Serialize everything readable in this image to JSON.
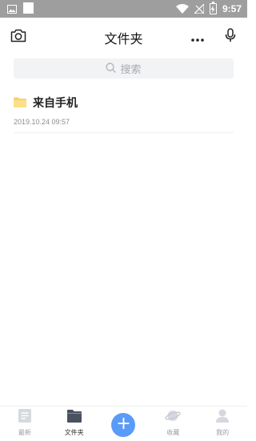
{
  "status_bar": {
    "time": "9:57",
    "left_icons": [
      "image-icon",
      "sim-card-icon"
    ],
    "right_icons": [
      "wifi-icon",
      "no-signal-icon",
      "battery-charging-icon"
    ]
  },
  "header": {
    "title": "文件夹",
    "left_icon": "camera-icon",
    "right_icons": [
      "more-icon",
      "microphone-icon"
    ]
  },
  "search": {
    "placeholder": "搜索"
  },
  "folders": [
    {
      "name": "来自手机",
      "date": "2019.10.24 09:57",
      "icon": "folder-icon"
    }
  ],
  "bottom_nav": {
    "items": [
      {
        "label": "最新",
        "icon": "document-icon",
        "active": false
      },
      {
        "label": "文件夹",
        "icon": "folder-icon",
        "active": true
      },
      {
        "label": "+",
        "icon": "add-icon",
        "active": false
      },
      {
        "label": "收藏",
        "icon": "planet-icon",
        "active": false
      },
      {
        "label": "我的",
        "icon": "person-icon",
        "active": false
      }
    ]
  },
  "colors": {
    "status_bar": "#9e9e9e",
    "accent": "#5b9bf8",
    "folder": "#f7d26b",
    "search_bg": "#f2f3f5"
  }
}
